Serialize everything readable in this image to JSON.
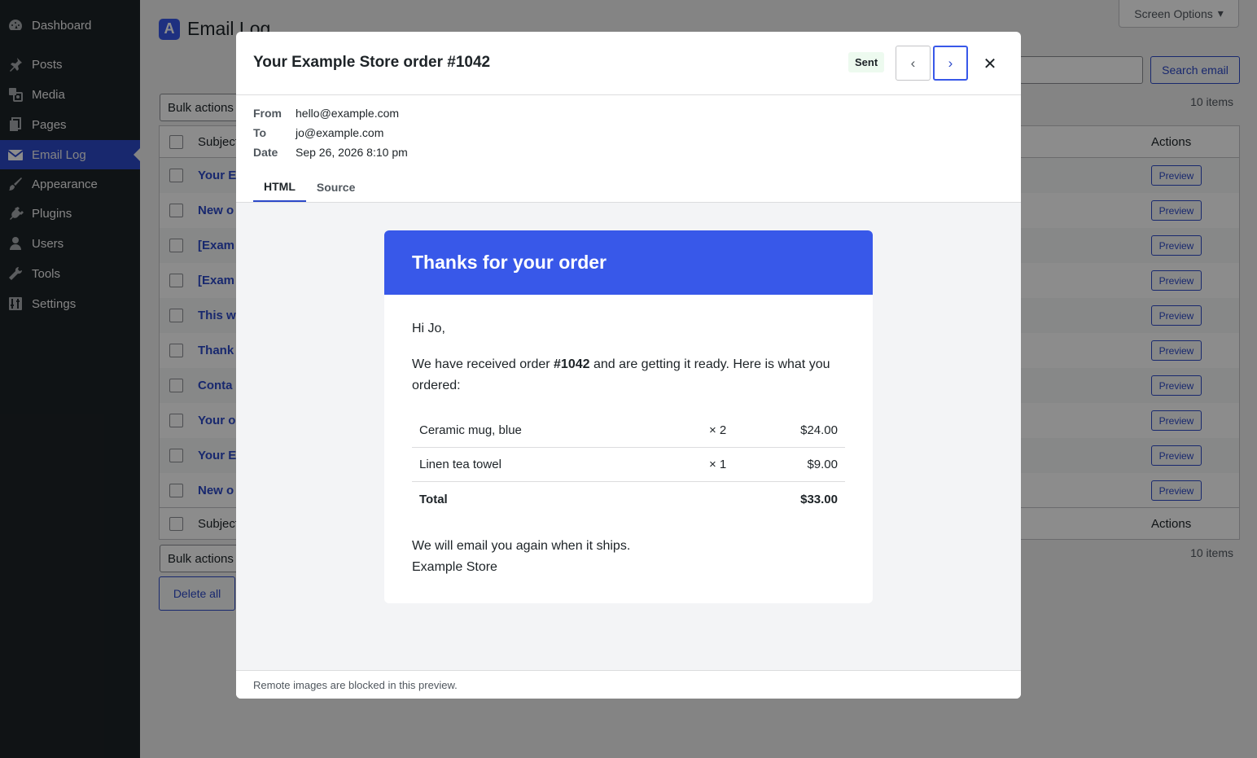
{
  "sidebar": {
    "items": [
      {
        "label": "Dashboard",
        "icon": "dashboard-icon"
      },
      {
        "label": "Posts",
        "icon": "pin-icon"
      },
      {
        "label": "Media",
        "icon": "media-icon"
      },
      {
        "label": "Pages",
        "icon": "pages-icon"
      },
      {
        "label": "Email Log",
        "icon": "email-icon"
      },
      {
        "label": "Appearance",
        "icon": "brush-icon"
      },
      {
        "label": "Plugins",
        "icon": "plugin-icon"
      },
      {
        "label": "Users",
        "icon": "user-icon"
      },
      {
        "label": "Tools",
        "icon": "wrench-icon"
      },
      {
        "label": "Settings",
        "icon": "settings-icon"
      }
    ],
    "current": "Email Log"
  },
  "page": {
    "logo_letter": "A",
    "title": "Email Log",
    "screen_options": "Screen Options",
    "search_button": "Search email",
    "bulk_actions": "Bulk actions",
    "items_count": "10 items",
    "delete_all": "Delete all"
  },
  "table": {
    "col_subject": "Subject",
    "col_actions": "Actions",
    "rows": [
      {
        "subject": "Your E"
      },
      {
        "subject": "New o"
      },
      {
        "subject": "[Exam"
      },
      {
        "subject": "[Exam"
      },
      {
        "subject": "This w"
      },
      {
        "subject": "Thank"
      },
      {
        "subject": "Conta"
      },
      {
        "subject": "Your o"
      },
      {
        "subject": "Your E"
      },
      {
        "subject": "New o"
      }
    ],
    "preview_label": "Preview"
  },
  "modal": {
    "title": "Your Example Store order #1042",
    "status": "Sent",
    "prev_glyph": "‹",
    "next_glyph": "›",
    "close_glyph": "✕",
    "meta": {
      "from_label": "From",
      "from_value": "hello@example.com",
      "to_label": "To",
      "to_value": "jo@example.com",
      "date_label": "Date",
      "date_value": "Sep 26, 2026 8:10 pm"
    },
    "tabs": [
      "HTML",
      "Source"
    ],
    "active_tab": "HTML",
    "footer_note": "Remote images are blocked in this preview."
  },
  "email": {
    "banner": "Thanks for your order",
    "greeting": "Hi Jo,",
    "intro_before": "We have received order ",
    "intro_order": "#1042",
    "intro_after": " and are getting it ready. Here is what you ordered:",
    "lines": [
      {
        "name": "Ceramic mug, blue",
        "qty": "× 2",
        "price": "$24.00"
      },
      {
        "name": "Linen tea towel",
        "qty": "× 1",
        "price": "$9.00"
      }
    ],
    "total_label": "Total",
    "total_value": "$33.00",
    "closing_1": "We will email you again when it ships.",
    "closing_2": "Example Store"
  },
  "colors": {
    "accent": "#3858e9",
    "link": "#2c49c9",
    "sidebar_bg": "#1d2327",
    "badge_bg": "#edfaef"
  }
}
